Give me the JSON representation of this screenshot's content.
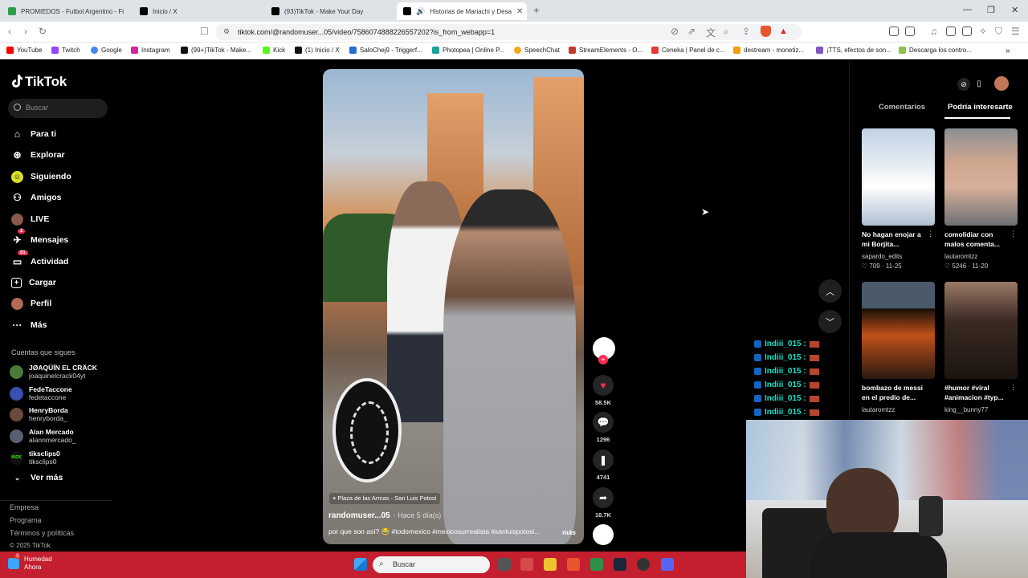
{
  "browser": {
    "tabs": [
      {
        "label": "PROMIEDOS - Futbol Argentino - Fi",
        "active": false
      },
      {
        "label": "Inicio / X",
        "active": false
      },
      {
        "label": "(93)TikTok - Make Your Day",
        "active": false
      },
      {
        "label": "Historias de Mariachi y Desa",
        "active": true
      }
    ],
    "url": "tiktok.com/@randomuser...05/video/7586074888226557202?is_from_webapp=1",
    "bookmarks": [
      "YouTube",
      "Twitch",
      "Google",
      "Instagram",
      "(99+)TikTok - Make...",
      "Kick",
      "(1) Inicio / X",
      "SaloChej9 - Triggerf...",
      "Photopea | Online P...",
      "SpeechChat",
      "StreamElements - O...",
      "Ceneka | Panel de c...",
      "destream - monetiz...",
      "¡TTS, efectos de son...",
      "Descarga los contro..."
    ]
  },
  "tiktok": {
    "logo": "TikTok",
    "search_placeholder": "Buscar",
    "nav": [
      "Para ti",
      "Explorar",
      "Siguiendo",
      "Amigos",
      "LIVE",
      "Mensajes",
      "Actividad",
      "Cargar",
      "Perfil",
      "Más"
    ],
    "nav_badges": {
      "mensajes": "2",
      "actividad": "91"
    },
    "following_title": "Cuentas que sigues",
    "following": [
      {
        "display": "JØAQÜÍN EL CRÄCK",
        "user": "joaquinelcrack04yt"
      },
      {
        "display": "FedeTaccone",
        "user": "fedetaccone"
      },
      {
        "display": "HenryBorda",
        "user": "henryborda_"
      },
      {
        "display": "Alan Mercado",
        "user": "alannmercado_"
      },
      {
        "display": "tiksclips0",
        "user": "tiksclips0"
      }
    ],
    "see_more": "Ver más",
    "footer": [
      "Empresa",
      "Programa",
      "Términos y políticas",
      "© 2025 TikTok"
    ]
  },
  "video": {
    "location": "Plaza de las Armas - San Luis Potosí",
    "author": "randomuser...05",
    "posted": "· Hace 5 día(s)",
    "description": "por que son así? 😂 #todomexico #mexicosurrealista #sanluispotosi...",
    "more": "más",
    "likes": "58.5K",
    "comments": "1296",
    "saves": "4741",
    "shares": "18.7K"
  },
  "right_panel": {
    "tabs": [
      "Comentarios",
      "Podría interesarte"
    ],
    "items": [
      {
        "caption": "No hagan enojar a mi Borjita...",
        "user": "sapardo_edits",
        "likes": "709",
        "date": "11-25"
      },
      {
        "caption": "comolidiar con malos comenta...",
        "user": "lautaromtzz",
        "likes": "5246",
        "date": "11-20"
      },
      {
        "caption": "bombazo de messi en el predio de...",
        "user": "lautaromtzz",
        "likes": "",
        "date": ""
      },
      {
        "caption": "#humor #viral #animacion #typ...",
        "user": "king__bunny77",
        "likes": "",
        "date": ""
      }
    ]
  },
  "chat": [
    "Indiii_015 :",
    "Indiii_015 :",
    "Indiii_015 :",
    "Indiii_015 :",
    "Indiii_015 :",
    "Indiii_015 :"
  ],
  "taskbar": {
    "weather_title": "Humedad",
    "weather_sub": "Ahora",
    "weather_badge": "3",
    "search": "Buscar"
  }
}
